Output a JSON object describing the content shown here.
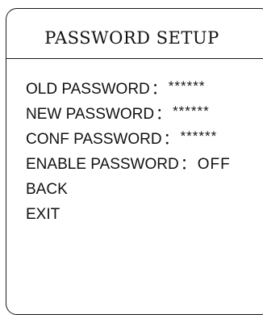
{
  "menu": {
    "title": "PASSWORD SETUP",
    "items": [
      {
        "label": "OLD PASSWORD",
        "separator": "：",
        "value": "******"
      },
      {
        "label": "NEW PASSWORD",
        "separator": "：",
        "value": "******"
      },
      {
        "label": "CONF PASSWORD",
        "separator": "：",
        "value": "******"
      },
      {
        "label": "ENABLE PASSWORD",
        "separator": "：",
        "value": "OFF"
      },
      {
        "label": "BACK"
      },
      {
        "label": "EXIT"
      }
    ]
  }
}
